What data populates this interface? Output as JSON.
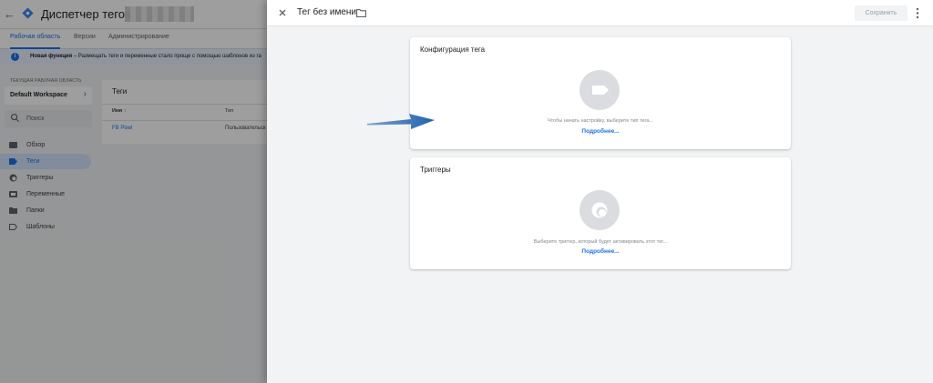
{
  "app": {
    "title": "Диспетчер тегов"
  },
  "nav_tabs": [
    {
      "label": "Рабочая область"
    },
    {
      "label": "Версии"
    },
    {
      "label": "Администрирование"
    }
  ],
  "banner": {
    "title": "Новая функция",
    "text": " – Размещать теги и переменные стало проще с помощью шаблонов из га"
  },
  "workspace": {
    "section_label": "ТЕКУЩАЯ РАБОЧАЯ ОБЛАСТЬ",
    "name": "Default Workspace"
  },
  "search": {
    "placeholder": "Поиск"
  },
  "sidebar": {
    "items": [
      {
        "label": "Обзор",
        "icon": "overview-icon"
      },
      {
        "label": "Теги",
        "icon": "tag-icon"
      },
      {
        "label": "Триггеры",
        "icon": "trigger-icon"
      },
      {
        "label": "Переменные",
        "icon": "variable-icon"
      },
      {
        "label": "Папки",
        "icon": "folder-icon"
      },
      {
        "label": "Шаблоны",
        "icon": "template-icon"
      }
    ],
    "active_index": 1
  },
  "tags_table": {
    "title": "Теги",
    "columns": [
      "Имя ↑",
      "Тип"
    ],
    "rows": [
      {
        "name": "FB Pixel",
        "type": "Пользовательск"
      }
    ]
  },
  "panel": {
    "title": "Тег без имени",
    "save_label": "Сохранить",
    "tag_config": {
      "title": "Конфигурация тега",
      "hint": "Чтобы начать настройку, выберите тип тега...",
      "link": "Подробнее..."
    },
    "triggers": {
      "title": "Триггеры",
      "hint": "Выберите триггер, который будет активировать этот тег...",
      "link": "Подробнее..."
    }
  },
  "colors": {
    "accent": "#1a73e8",
    "annotation_arrow": "#1f5fae",
    "placeholder_circle": "#dadce0"
  }
}
